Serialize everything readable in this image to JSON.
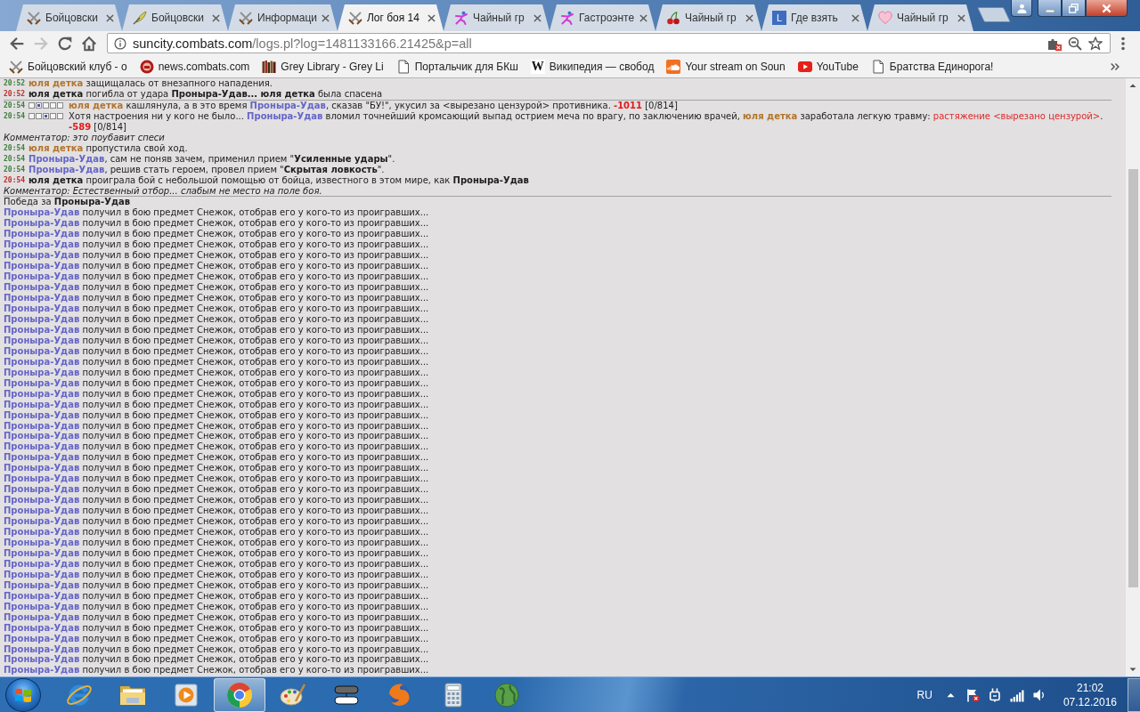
{
  "browser": {
    "tabs": [
      {
        "title": "Бойцовски",
        "selected": false
      },
      {
        "title": "Бойцовски",
        "selected": false
      },
      {
        "title": "Информаци",
        "selected": false
      },
      {
        "title": "Лог боя 14",
        "selected": true
      },
      {
        "title": "Чайный гр",
        "selected": false
      },
      {
        "title": "Гастроэнте",
        "selected": false
      },
      {
        "title": "Чайный гр",
        "selected": false
      },
      {
        "title": "Где взять",
        "selected": false,
        "icon_letter": "L"
      },
      {
        "title": "Чайный гр",
        "selected": false
      }
    ],
    "navigation": {
      "back_disabled": false,
      "forward_disabled": true
    },
    "address": {
      "host": "suncity.combats.com",
      "path": "/logs.pl?log=1481133166.21425&p=all"
    },
    "bookmarked": false,
    "bookmarks": [
      {
        "title": "Бойцовский клуб - о"
      },
      {
        "title": "news.combats.com"
      },
      {
        "title": "Grey Library - Grey Li"
      },
      {
        "title": "Портальчик для БКш"
      },
      {
        "title": "Википедия — свобод",
        "icon_letter": "W"
      },
      {
        "title": "Your stream on Soun"
      },
      {
        "title": "YouTube"
      },
      {
        "title": "Братства Единорога!"
      }
    ]
  },
  "log": [
    {
      "kind": "event",
      "time": {
        "text": "20:52",
        "color": "#3f7f3f"
      },
      "parts": [
        {
          "kind": "bold",
          "color": "#b3742b",
          "text": "юля детка"
        },
        {
          "kind": "plain",
          "text": " защищалась от внезапного нападения."
        }
      ]
    },
    {
      "kind": "event",
      "time": {
        "text": "20:52",
        "color": "#c03030"
      },
      "parts": [
        {
          "kind": "bold",
          "text": "юля детка"
        },
        {
          "kind": "plain",
          "text": " погибла от удара "
        },
        {
          "kind": "bold",
          "text": "Проныра-Удав... юля детка"
        },
        {
          "kind": "plain",
          "text": " была спасена"
        }
      ]
    },
    {
      "kind": "divider"
    },
    {
      "kind": "event",
      "time": {
        "text": "20:54",
        "color": "#3f7f3f"
      },
      "zones": [
        {
          "selected": false
        },
        {
          "selected": true
        },
        {
          "selected": false
        },
        {
          "selected": false
        },
        {
          "selected": false
        }
      ],
      "parts": [
        {
          "kind": "bold",
          "color": "#b3742b",
          "text": "юля детка"
        },
        {
          "kind": "plain",
          "text": " кашлянула, а в это время "
        },
        {
          "kind": "bold",
          "color": "#6565c8",
          "text": "Проныра-Удав"
        },
        {
          "kind": "plain",
          "text": ", сказав \"БУ!\", укусил за <вырезано цензурой> противника. "
        },
        {
          "kind": "bold",
          "color": "#e01b1b",
          "text": "-1011"
        },
        {
          "kind": "plain",
          "text": " [0/814]"
        }
      ]
    },
    {
      "kind": "event",
      "time": {
        "text": "20:54",
        "color": "#3f7f3f"
      },
      "zones": [
        {
          "selected": false
        },
        {
          "selected": false
        },
        {
          "selected": true
        },
        {
          "selected": false
        },
        {
          "selected": false
        }
      ],
      "parts": [
        {
          "kind": "plain",
          "text": "Хотя настроения ни у кого не было... "
        },
        {
          "kind": "bold",
          "color": "#6565c8",
          "text": "Проныра-Удав"
        },
        {
          "kind": "plain",
          "text": " вломил точнейший кромсающий выпад острием меча по врагу, по заключению врачей, "
        },
        {
          "kind": "bold",
          "color": "#b3742b",
          "text": "юля детка"
        },
        {
          "kind": "plain",
          "text": " заработала легкую травму: "
        },
        {
          "kind": "plain",
          "color": "#dc2a2a",
          "text": "растяжение <вырезано цензурой>"
        },
        {
          "kind": "plain",
          "text": ". "
        },
        {
          "kind": "bold",
          "color": "#e01b1b",
          "text": "-589"
        },
        {
          "kind": "plain",
          "text": " [0/814]"
        }
      ]
    },
    {
      "kind": "comment",
      "text": "Комментатор: это поубавит спеси"
    },
    {
      "kind": "event",
      "time": {
        "text": "20:54",
        "color": "#3f7f3f"
      },
      "parts": [
        {
          "kind": "bold",
          "color": "#b3742b",
          "text": "юля детка"
        },
        {
          "kind": "plain",
          "text": " пропустила свой ход."
        }
      ]
    },
    {
      "kind": "event",
      "time": {
        "text": "20:54",
        "color": "#3f7f3f"
      },
      "parts": [
        {
          "kind": "bold",
          "color": "#6565c8",
          "text": "Проныра-Удав"
        },
        {
          "kind": "plain",
          "text": ", сам не поняв зачем, применил прием \""
        },
        {
          "kind": "bold",
          "text": "Усиленные удары"
        },
        {
          "kind": "plain",
          "text": "\"."
        }
      ]
    },
    {
      "kind": "event",
      "time": {
        "text": "20:54",
        "color": "#3f7f3f"
      },
      "parts": [
        {
          "kind": "bold",
          "color": "#6565c8",
          "text": "Проныра-Удав"
        },
        {
          "kind": "plain",
          "text": ", решив стать героем, провел прием \""
        },
        {
          "kind": "bold",
          "text": "Скрытая ловкость"
        },
        {
          "kind": "plain",
          "text": "\"."
        }
      ]
    },
    {
      "kind": "event",
      "time": {
        "text": "20:54",
        "color": "#c03030"
      },
      "parts": [
        {
          "kind": "bold",
          "text": "юля детка"
        },
        {
          "kind": "plain",
          "text": " проиграла бой с небольшой помощью от бойца, известного в этом мире, как "
        },
        {
          "kind": "bold",
          "text": "Проныра-Удав"
        }
      ]
    },
    {
      "kind": "comment",
      "text": "Комментатор: Естественный отбор... слабым не место на поле боя."
    },
    {
      "kind": "divider"
    },
    {
      "kind": "event",
      "parts": [
        {
          "kind": "plain",
          "text": "Победа за "
        },
        {
          "kind": "bold",
          "text": "Проныра-Удав"
        }
      ]
    },
    {
      "kind": "event",
      "parts": [
        {
          "kind": "bold",
          "color": "#6565c8",
          "text": "Проныра-Удав"
        },
        {
          "kind": "plain",
          "text": " получил в бою предмет Снежок, отобрав его у кого-то из проигравших..."
        }
      ]
    },
    {
      "kind": "event",
      "parts": [
        {
          "kind": "bold",
          "color": "#6565c8",
          "text": "Проныра-Удав"
        },
        {
          "kind": "plain",
          "text": " получил в бою предмет Снежок, отобрав его у кого-то из проигравших..."
        }
      ]
    },
    {
      "kind": "event",
      "parts": [
        {
          "kind": "bold",
          "color": "#6565c8",
          "text": "Проныра-Удав"
        },
        {
          "kind": "plain",
          "text": " получил в бою предмет Снежок, отобрав его у кого-то из проигравших..."
        }
      ]
    },
    {
      "kind": "event",
      "parts": [
        {
          "kind": "bold",
          "color": "#6565c8",
          "text": "Проныра-Удав"
        },
        {
          "kind": "plain",
          "text": " получил в бою предмет Снежок, отобрав его у кого-то из проигравших..."
        }
      ]
    },
    {
      "kind": "event",
      "parts": [
        {
          "kind": "bold",
          "color": "#6565c8",
          "text": "Проныра-Удав"
        },
        {
          "kind": "plain",
          "text": " получил в бою предмет Снежок, отобрав его у кого-то из проигравших..."
        }
      ]
    },
    {
      "kind": "event",
      "parts": [
        {
          "kind": "bold",
          "color": "#6565c8",
          "text": "Проныра-Удав"
        },
        {
          "kind": "plain",
          "text": " получил в бою предмет Снежок, отобрав его у кого-то из проигравших..."
        }
      ]
    },
    {
      "kind": "event",
      "parts": [
        {
          "kind": "bold",
          "color": "#6565c8",
          "text": "Проныра-Удав"
        },
        {
          "kind": "plain",
          "text": " получил в бою предмет Снежок, отобрав его у кого-то из проигравших..."
        }
      ]
    },
    {
      "kind": "event",
      "parts": [
        {
          "kind": "bold",
          "color": "#6565c8",
          "text": "Проныра-Удав"
        },
        {
          "kind": "plain",
          "text": " получил в бою предмет Снежок, отобрав его у кого-то из проигравших..."
        }
      ]
    },
    {
      "kind": "event",
      "parts": [
        {
          "kind": "bold",
          "color": "#6565c8",
          "text": "Проныра-Удав"
        },
        {
          "kind": "plain",
          "text": " получил в бою предмет Снежок, отобрав его у кого-то из проигравших..."
        }
      ]
    },
    {
      "kind": "event",
      "parts": [
        {
          "kind": "bold",
          "color": "#6565c8",
          "text": "Проныра-Удав"
        },
        {
          "kind": "plain",
          "text": " получил в бою предмет Снежок, отобрав его у кого-то из проигравших..."
        }
      ]
    },
    {
      "kind": "event",
      "parts": [
        {
          "kind": "bold",
          "color": "#6565c8",
          "text": "Проныра-Удав"
        },
        {
          "kind": "plain",
          "text": " получил в бою предмет Снежок, отобрав его у кого-то из проигравших..."
        }
      ]
    },
    {
      "kind": "event",
      "parts": [
        {
          "kind": "bold",
          "color": "#6565c8",
          "text": "Проныра-Удав"
        },
        {
          "kind": "plain",
          "text": " получил в бою предмет Снежок, отобрав его у кого-то из проигравших..."
        }
      ]
    },
    {
      "kind": "event",
      "parts": [
        {
          "kind": "bold",
          "color": "#6565c8",
          "text": "Проныра-Удав"
        },
        {
          "kind": "plain",
          "text": " получил в бою предмет Снежок, отобрав его у кого-то из проигравших..."
        }
      ]
    },
    {
      "kind": "event",
      "parts": [
        {
          "kind": "bold",
          "color": "#6565c8",
          "text": "Проныра-Удав"
        },
        {
          "kind": "plain",
          "text": " получил в бою предмет Снежок, отобрав его у кого-то из проигравших..."
        }
      ]
    },
    {
      "kind": "event",
      "parts": [
        {
          "kind": "bold",
          "color": "#6565c8",
          "text": "Проныра-Удав"
        },
        {
          "kind": "plain",
          "text": " получил в бою предмет Снежок, отобрав его у кого-то из проигравших..."
        }
      ]
    },
    {
      "kind": "event",
      "parts": [
        {
          "kind": "bold",
          "color": "#6565c8",
          "text": "Проныра-Удав"
        },
        {
          "kind": "plain",
          "text": " получил в бою предмет Снежок, отобрав его у кого-то из проигравших..."
        }
      ]
    },
    {
      "kind": "event",
      "parts": [
        {
          "kind": "bold",
          "color": "#6565c8",
          "text": "Проныра-Удав"
        },
        {
          "kind": "plain",
          "text": " получил в бою предмет Снежок, отобрав его у кого-то из проигравших..."
        }
      ]
    },
    {
      "kind": "event",
      "parts": [
        {
          "kind": "bold",
          "color": "#6565c8",
          "text": "Проныра-Удав"
        },
        {
          "kind": "plain",
          "text": " получил в бою предмет Снежок, отобрав его у кого-то из проигравших..."
        }
      ]
    },
    {
      "kind": "event",
      "parts": [
        {
          "kind": "bold",
          "color": "#6565c8",
          "text": "Проныра-Удав"
        },
        {
          "kind": "plain",
          "text": " получил в бою предмет Снежок, отобрав его у кого-то из проигравших..."
        }
      ]
    },
    {
      "kind": "event",
      "parts": [
        {
          "kind": "bold",
          "color": "#6565c8",
          "text": "Проныра-Удав"
        },
        {
          "kind": "plain",
          "text": " получил в бою предмет Снежок, отобрав его у кого-то из проигравших..."
        }
      ]
    },
    {
      "kind": "event",
      "parts": [
        {
          "kind": "bold",
          "color": "#6565c8",
          "text": "Проныра-Удав"
        },
        {
          "kind": "plain",
          "text": " получил в бою предмет Снежок, отобрав его у кого-то из проигравших..."
        }
      ]
    },
    {
      "kind": "event",
      "parts": [
        {
          "kind": "bold",
          "color": "#6565c8",
          "text": "Проныра-Удав"
        },
        {
          "kind": "plain",
          "text": " получил в бою предмет Снежок, отобрав его у кого-то из проигравших..."
        }
      ]
    },
    {
      "kind": "event",
      "parts": [
        {
          "kind": "bold",
          "color": "#6565c8",
          "text": "Проныра-Удав"
        },
        {
          "kind": "plain",
          "text": " получил в бою предмет Снежок, отобрав его у кого-то из проигравших..."
        }
      ]
    },
    {
      "kind": "event",
      "parts": [
        {
          "kind": "bold",
          "color": "#6565c8",
          "text": "Проныра-Удав"
        },
        {
          "kind": "plain",
          "text": " получил в бою предмет Снежок, отобрав его у кого-то из проигравших..."
        }
      ]
    },
    {
      "kind": "event",
      "parts": [
        {
          "kind": "bold",
          "color": "#6565c8",
          "text": "Проныра-Удав"
        },
        {
          "kind": "plain",
          "text": " получил в бою предмет Снежок, отобрав его у кого-то из проигравших..."
        }
      ]
    },
    {
      "kind": "event",
      "parts": [
        {
          "kind": "bold",
          "color": "#6565c8",
          "text": "Проныра-Удав"
        },
        {
          "kind": "plain",
          "text": " получил в бою предмет Снежок, отобрав его у кого-то из проигравших..."
        }
      ]
    },
    {
      "kind": "event",
      "parts": [
        {
          "kind": "bold",
          "color": "#6565c8",
          "text": "Проныра-Удав"
        },
        {
          "kind": "plain",
          "text": " получил в бою предмет Снежок, отобрав его у кого-то из проигравших..."
        }
      ]
    },
    {
      "kind": "event",
      "parts": [
        {
          "kind": "bold",
          "color": "#6565c8",
          "text": "Проныра-Удав"
        },
        {
          "kind": "plain",
          "text": " получил в бою предмет Снежок, отобрав его у кого-то из проигравших..."
        }
      ]
    },
    {
      "kind": "event",
      "parts": [
        {
          "kind": "bold",
          "color": "#6565c8",
          "text": "Проныра-Удав"
        },
        {
          "kind": "plain",
          "text": " получил в бою предмет Снежок, отобрав его у кого-то из проигравших..."
        }
      ]
    },
    {
      "kind": "event",
      "parts": [
        {
          "kind": "bold",
          "color": "#6565c8",
          "text": "Проныра-Удав"
        },
        {
          "kind": "plain",
          "text": " получил в бою предмет Снежок, отобрав его у кого-то из проигравших..."
        }
      ]
    },
    {
      "kind": "event",
      "parts": [
        {
          "kind": "bold",
          "color": "#6565c8",
          "text": "Проныра-Удав"
        },
        {
          "kind": "plain",
          "text": " получил в бою предмет Снежок, отобрав его у кого-то из проигравших..."
        }
      ]
    },
    {
      "kind": "event",
      "parts": [
        {
          "kind": "bold",
          "color": "#6565c8",
          "text": "Проныра-Удав"
        },
        {
          "kind": "plain",
          "text": " получил в бою предмет Снежок, отобрав его у кого-то из проигравших..."
        }
      ]
    },
    {
      "kind": "event",
      "parts": [
        {
          "kind": "bold",
          "color": "#6565c8",
          "text": "Проныра-Удав"
        },
        {
          "kind": "plain",
          "text": " получил в бою предмет Снежок, отобрав его у кого-то из проигравших..."
        }
      ]
    },
    {
      "kind": "event",
      "parts": [
        {
          "kind": "bold",
          "color": "#6565c8",
          "text": "Проныра-Удав"
        },
        {
          "kind": "plain",
          "text": " получил в бою предмет Снежок, отобрав его у кого-то из проигравших..."
        }
      ]
    },
    {
      "kind": "event",
      "parts": [
        {
          "kind": "bold",
          "color": "#6565c8",
          "text": "Проныра-Удав"
        },
        {
          "kind": "plain",
          "text": " получил в бою предмет Снежок, отобрав его у кого-то из проигравших..."
        }
      ]
    },
    {
      "kind": "event",
      "parts": [
        {
          "kind": "bold",
          "color": "#6565c8",
          "text": "Проныра-Удав"
        },
        {
          "kind": "plain",
          "text": " получил в бою предмет Снежок, отобрав его у кого-то из проигравших..."
        }
      ]
    },
    {
      "kind": "event",
      "parts": [
        {
          "kind": "bold",
          "color": "#6565c8",
          "text": "Проныра-Удав"
        },
        {
          "kind": "plain",
          "text": " получил в бою предмет Снежок, отобрав его у кого-то из проигравших..."
        }
      ]
    },
    {
      "kind": "event",
      "parts": [
        {
          "kind": "bold",
          "color": "#6565c8",
          "text": "Проныра-Удав"
        },
        {
          "kind": "plain",
          "text": " получил в бою предмет Снежок, отобрав его у кого-то из проигравших..."
        }
      ]
    },
    {
      "kind": "event",
      "parts": [
        {
          "kind": "bold",
          "color": "#6565c8",
          "text": "Проныра-Удав"
        },
        {
          "kind": "plain",
          "text": " получил в бою предмет Снежок, отобрав его у кого-то из проигравших..."
        }
      ]
    },
    {
      "kind": "event",
      "parts": [
        {
          "kind": "bold",
          "color": "#6565c8",
          "text": "Проныра-Удав"
        },
        {
          "kind": "plain",
          "text": " получил в бою предмет Снежок, отобрав его у кого-то из проигравших..."
        }
      ]
    },
    {
      "kind": "event",
      "parts": [
        {
          "kind": "bold",
          "color": "#6565c8",
          "text": "Проныра-Удав"
        },
        {
          "kind": "plain",
          "text": " получил в бою предмет Снежок, отобрав его у кого-то из проигравших..."
        }
      ]
    },
    {
      "kind": "event",
      "parts": [
        {
          "kind": "bold",
          "color": "#6565c8",
          "text": "Проныра-Удав"
        },
        {
          "kind": "plain",
          "text": " получил в бою предмет Снежок, отобрав его у кого-то из проигравших..."
        }
      ]
    },
    {
      "kind": "event",
      "parts": [
        {
          "kind": "bold",
          "color": "#6565c8",
          "text": "Проныра-Удав"
        },
        {
          "kind": "plain",
          "text": " получил в бою предмет Снежок, отобрав его у кого-то из проигравших..."
        }
      ]
    },
    {
      "kind": "event",
      "parts": [
        {
          "kind": "bold",
          "color": "#6565c8",
          "text": "Проныра-Удав"
        },
        {
          "kind": "plain",
          "text": " получил в бою предмет Снежок, отобрав его у кого-то из проигравших..."
        }
      ]
    }
  ],
  "taskbar": {
    "apps": [
      {
        "selected": false
      },
      {
        "selected": false
      },
      {
        "selected": false
      },
      {
        "selected": true
      },
      {
        "selected": false
      },
      {
        "selected": false
      },
      {
        "selected": false
      },
      {
        "selected": false
      },
      {
        "selected": false
      }
    ],
    "language": "RU",
    "time": "21:02",
    "date": "07.12.2016"
  }
}
